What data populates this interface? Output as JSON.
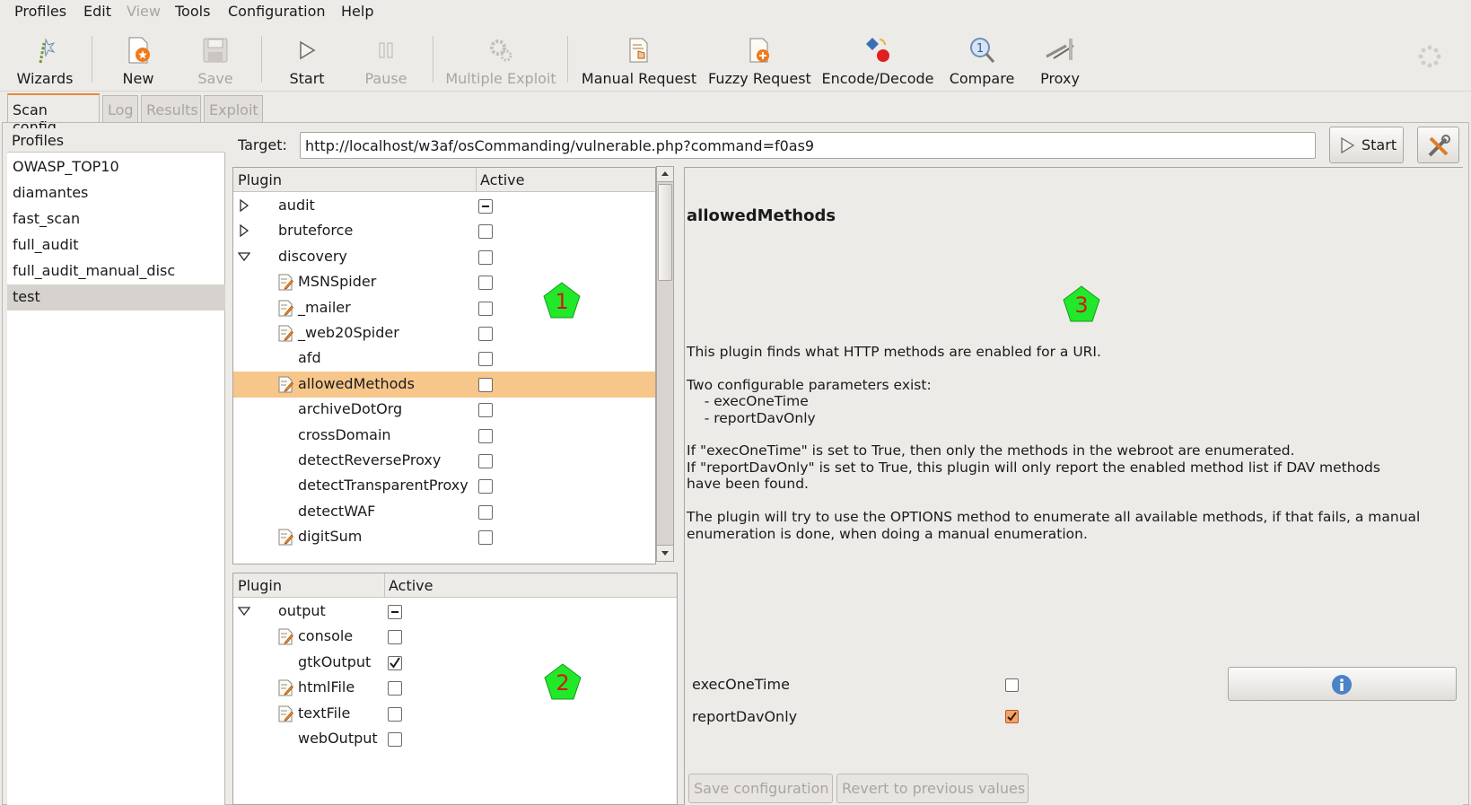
{
  "menu": [
    "Profiles",
    "Edit",
    "View",
    "Tools",
    "Configuration",
    "Help"
  ],
  "toolbar": {
    "wizards": "Wizards",
    "new": "New",
    "save": "Save",
    "start": "Start",
    "pause": "Pause",
    "multiple_exploit": "Multiple Exploit",
    "manual_request": "Manual Request",
    "fuzzy_request": "Fuzzy Request",
    "encode_decode": "Encode/Decode",
    "compare": "Compare",
    "proxy": "Proxy"
  },
  "tabs": [
    "Scan config",
    "Log",
    "Results",
    "Exploit"
  ],
  "profiles": {
    "header": "Profiles",
    "items": [
      "OWASP_TOP10",
      "diamantes",
      "fast_scan",
      "full_audit",
      "full_audit_manual_disc",
      "test"
    ],
    "selected": "test"
  },
  "target": {
    "label": "Target:",
    "value": "http://localhost/w3af/osCommanding/vulnerable.php?command=f0as9",
    "start_button": "Start"
  },
  "plugin_tree": {
    "col_plugin": "Plugin",
    "col_active": "Active",
    "rows": [
      {
        "name": "audit",
        "level": 0,
        "expander": "collapsed",
        "check": "inconsistent"
      },
      {
        "name": "bruteforce",
        "level": 0,
        "expander": "collapsed",
        "check": "unchecked"
      },
      {
        "name": "discovery",
        "level": 0,
        "expander": "expanded",
        "check": "unchecked"
      },
      {
        "name": "MSNSpider",
        "level": 1,
        "icon": true,
        "check": "unchecked"
      },
      {
        "name": "_mailer",
        "level": 1,
        "icon": true,
        "check": "unchecked"
      },
      {
        "name": "_web20Spider",
        "level": 1,
        "icon": true,
        "check": "unchecked"
      },
      {
        "name": "afd",
        "level": 1,
        "icon": false,
        "check": "unchecked"
      },
      {
        "name": "allowedMethods",
        "level": 1,
        "icon": true,
        "check": "unchecked",
        "selected": true
      },
      {
        "name": "archiveDotOrg",
        "level": 1,
        "icon": false,
        "check": "unchecked"
      },
      {
        "name": "crossDomain",
        "level": 1,
        "icon": false,
        "check": "unchecked"
      },
      {
        "name": "detectReverseProxy",
        "level": 1,
        "icon": false,
        "check": "unchecked"
      },
      {
        "name": "detectTransparentProxy",
        "level": 1,
        "icon": false,
        "check": "unchecked"
      },
      {
        "name": "detectWAF",
        "level": 1,
        "icon": false,
        "check": "unchecked"
      },
      {
        "name": "digitSum",
        "level": 1,
        "icon": true,
        "check": "unchecked"
      }
    ]
  },
  "output_tree": {
    "col_plugin": "Plugin",
    "col_active": "Active",
    "rows": [
      {
        "name": "output",
        "level": 0,
        "expander": "expanded",
        "check": "inconsistent"
      },
      {
        "name": "console",
        "level": 1,
        "icon": true,
        "check": "unchecked"
      },
      {
        "name": "gtkOutput",
        "level": 1,
        "icon": false,
        "check": "checked"
      },
      {
        "name": "htmlFile",
        "level": 1,
        "icon": true,
        "check": "unchecked"
      },
      {
        "name": "textFile",
        "level": 1,
        "icon": true,
        "check": "unchecked"
      },
      {
        "name": "webOutput",
        "level": 1,
        "icon": false,
        "check": "unchecked"
      }
    ]
  },
  "markers": [
    "1",
    "2",
    "3"
  ],
  "description": {
    "title": "allowedMethods",
    "lines": [
      "This plugin finds what HTTP methods are enabled for a URI.",
      "",
      "Two configurable parameters exist:",
      "    - execOneTime",
      "    - reportDavOnly",
      "",
      "If \"execOneTime\" is set to True, then only the methods in the webroot are enumerated.",
      "If \"reportDavOnly\" is set to True, this plugin will only report the enabled method list if DAV methods",
      "have been found.",
      "",
      "The plugin will try to use the OPTIONS method to enumerate all available methods, if that fails, a manual",
      "enumeration is done, when doing a manual enumeration."
    ]
  },
  "options": [
    {
      "name": "execOneTime",
      "checked": false
    },
    {
      "name": "reportDavOnly",
      "checked": true
    }
  ],
  "buttons": {
    "save_config": "Save configuration",
    "revert": "Revert to previous values"
  }
}
